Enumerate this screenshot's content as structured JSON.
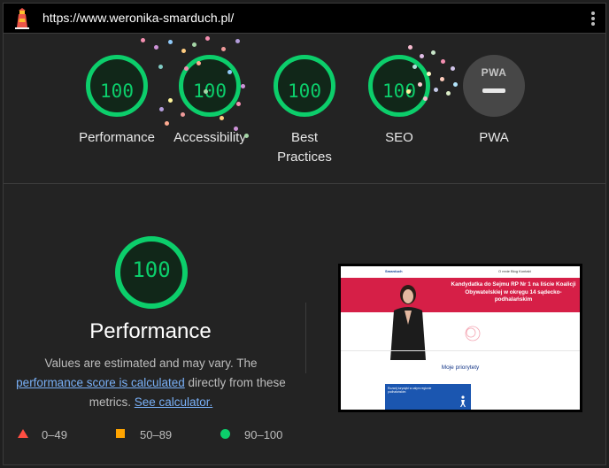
{
  "topbar": {
    "url": "https://www.weronika-smarduch.pl/",
    "logo_icon": "lighthouse-icon",
    "menu_icon": "kebab-menu-icon"
  },
  "gauges": [
    {
      "score": "100",
      "label": "Performance"
    },
    {
      "score": "100",
      "label": "Accessibility"
    },
    {
      "score": "100",
      "label": "Best Practices"
    },
    {
      "score": "100",
      "label": "SEO"
    }
  ],
  "pwa": {
    "badge": "PWA",
    "label": "PWA"
  },
  "performance": {
    "score": "100",
    "title": "Performance",
    "note_prefix": "Values are estimated and may vary. The",
    "note_link": "performance score is calculated",
    "note_middle": "directly from these metrics.",
    "calc_link": "See calculator."
  },
  "legend": [
    {
      "range": "0–49",
      "shape": "triangle",
      "color": "#ff4e42"
    },
    {
      "range": "50–89",
      "shape": "square",
      "color": "#ffa400"
    },
    {
      "range": "90–100",
      "shape": "circle",
      "color": "#0cce6b"
    }
  ],
  "thumbnail": {
    "brand": "Smarduch",
    "nav_links": "O mnie   Blog   Kontakt",
    "headline": "Kandydatka do Sejmu RP Nr 1 na liście Koalicji Obywatelskiej w okręgu 14 sądecko-podhalańskim",
    "section_title": "Moje priorytety",
    "card_text": "Rozwój turystyki w całym regionie podhalańskim"
  },
  "colors": {
    "pass": "#0cce6b",
    "average": "#ffa400",
    "fail": "#ff4e42",
    "link": "#79b0f7",
    "background": "#232323"
  }
}
